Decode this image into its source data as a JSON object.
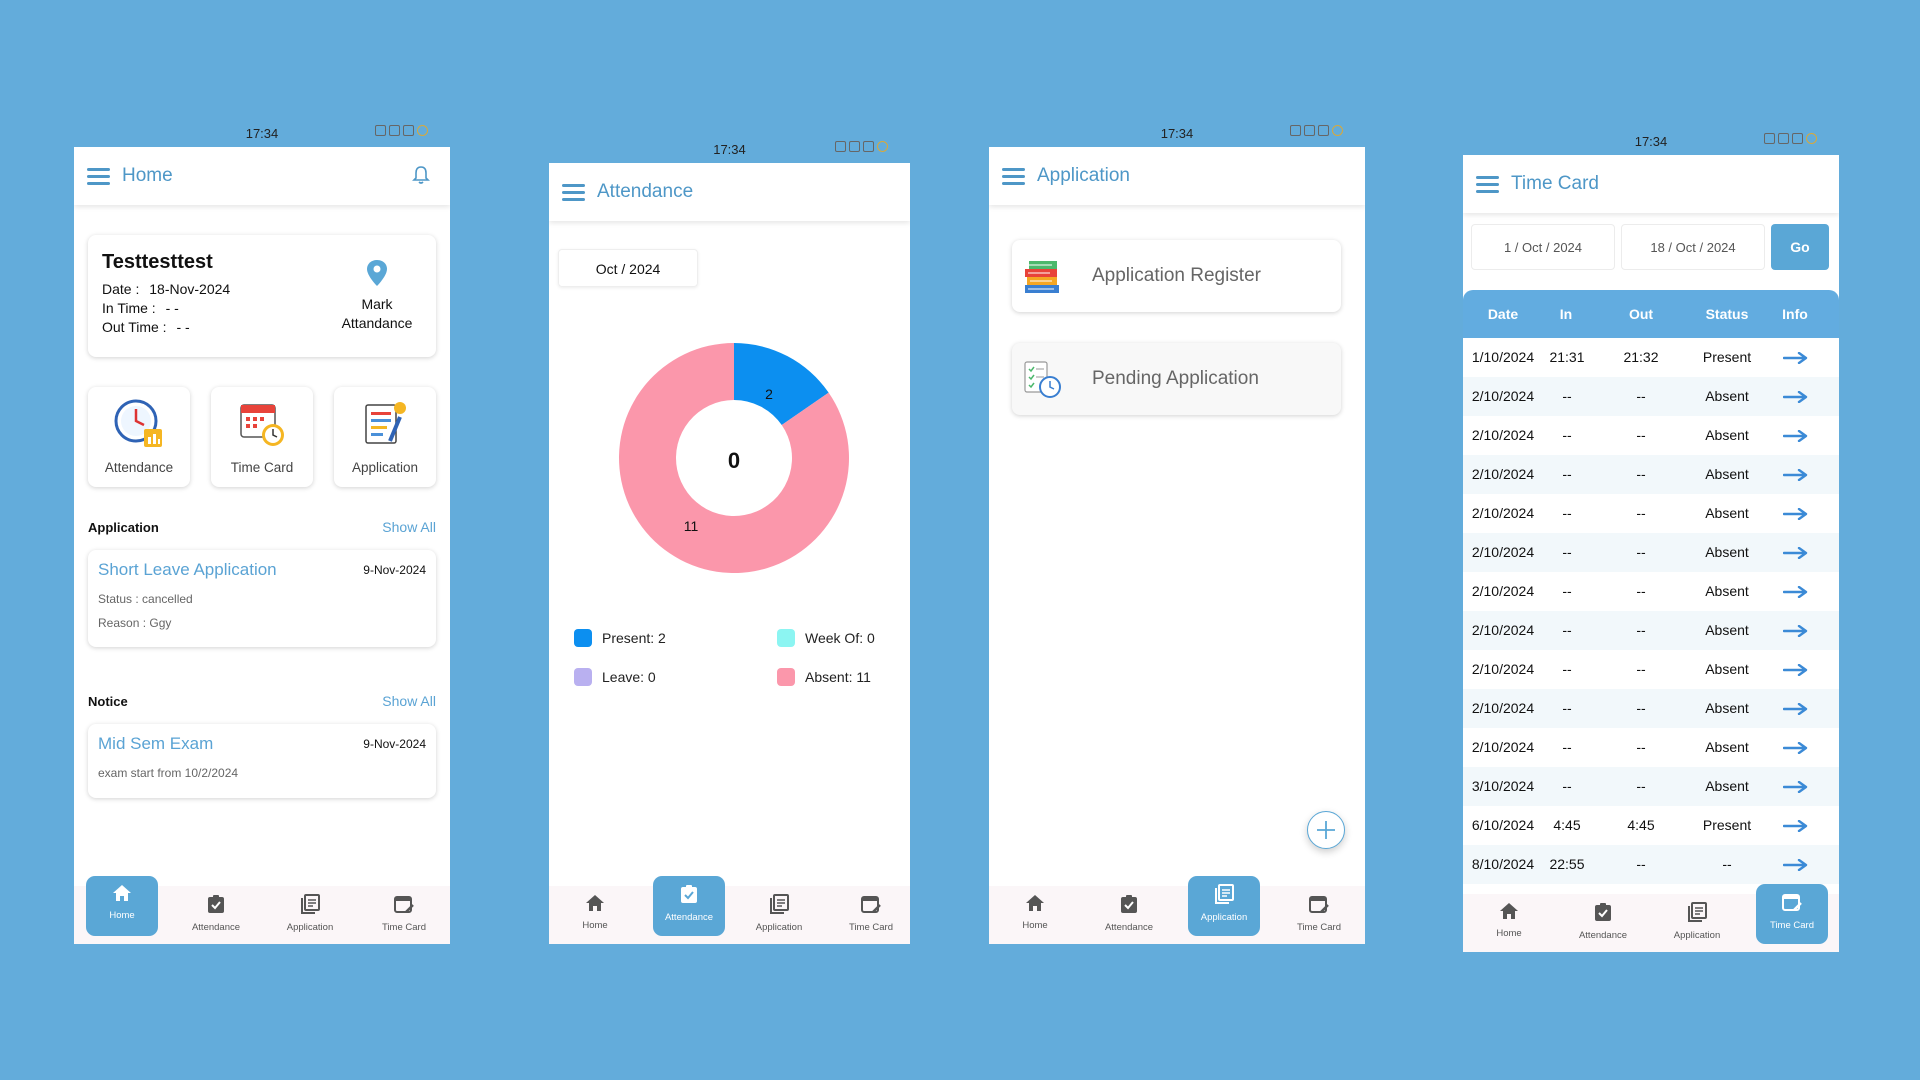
{
  "status": {
    "time_home": "17:34",
    "time_att": "17:34",
    "time_app": "17:34",
    "time_tc": "17:34"
  },
  "nav": {
    "home": "Home",
    "attendance": "Attendance",
    "application": "Application",
    "timecard": "Time Card"
  },
  "home": {
    "title": "Home",
    "user_name": "Testtesttest",
    "date_label": "Date :",
    "date_value": "18-Nov-2024",
    "in_label": "In Time :",
    "in_value": "- -",
    "out_label": "Out Time :",
    "out_value": "- -",
    "mark_line1": "Mark",
    "mark_line2": "Attandance",
    "tiles": [
      "Attendance",
      "Time Card",
      "Application"
    ],
    "application_section": "Application",
    "notice_section": "Notice",
    "show_all": "Show All",
    "app_card": {
      "title": "Short Leave Application",
      "date": "9-Nov-2024",
      "status": "Status : cancelled",
      "reason": "Reason : Ggy"
    },
    "notice_card": {
      "title": "Mid Sem Exam",
      "date": "9-Nov-2024",
      "desc": "exam start from 10/2/2024"
    }
  },
  "attendance": {
    "title": "Attendance",
    "month": "Oct / 2024",
    "center_value": "0",
    "slice_present": "2",
    "slice_absent": "11",
    "legend": {
      "present": "Present: 2",
      "weekoff": "Week Of: 0",
      "leave": "Leave: 0",
      "absent": "Absent: 11"
    },
    "colors": {
      "present": "#0c8ff0",
      "weekoff": "#8cf5f2",
      "leave": "#b9b0f0",
      "absent": "#fb97ab"
    }
  },
  "application": {
    "title": "Application",
    "register": "Application Register",
    "pending": "Pending Application"
  },
  "timecard": {
    "title": "Time Card",
    "from": "1 / Oct / 2024",
    "to": "18 / Oct / 2024",
    "go": "Go",
    "headers": [
      "Date",
      "In",
      "Out",
      "Status",
      "Info"
    ],
    "rows": [
      [
        "1/10/2024",
        "21:31",
        "21:32",
        "Present"
      ],
      [
        "2/10/2024",
        "--",
        "--",
        "Absent"
      ],
      [
        "2/10/2024",
        "--",
        "--",
        "Absent"
      ],
      [
        "2/10/2024",
        "--",
        "--",
        "Absent"
      ],
      [
        "2/10/2024",
        "--",
        "--",
        "Absent"
      ],
      [
        "2/10/2024",
        "--",
        "--",
        "Absent"
      ],
      [
        "2/10/2024",
        "--",
        "--",
        "Absent"
      ],
      [
        "2/10/2024",
        "--",
        "--",
        "Absent"
      ],
      [
        "2/10/2024",
        "--",
        "--",
        "Absent"
      ],
      [
        "2/10/2024",
        "--",
        "--",
        "Absent"
      ],
      [
        "2/10/2024",
        "--",
        "--",
        "Absent"
      ],
      [
        "3/10/2024",
        "--",
        "--",
        "Absent"
      ],
      [
        "6/10/2024",
        "4:45",
        "4:45",
        "Present"
      ],
      [
        "8/10/2024",
        "22:55",
        "--",
        "--"
      ]
    ]
  }
}
